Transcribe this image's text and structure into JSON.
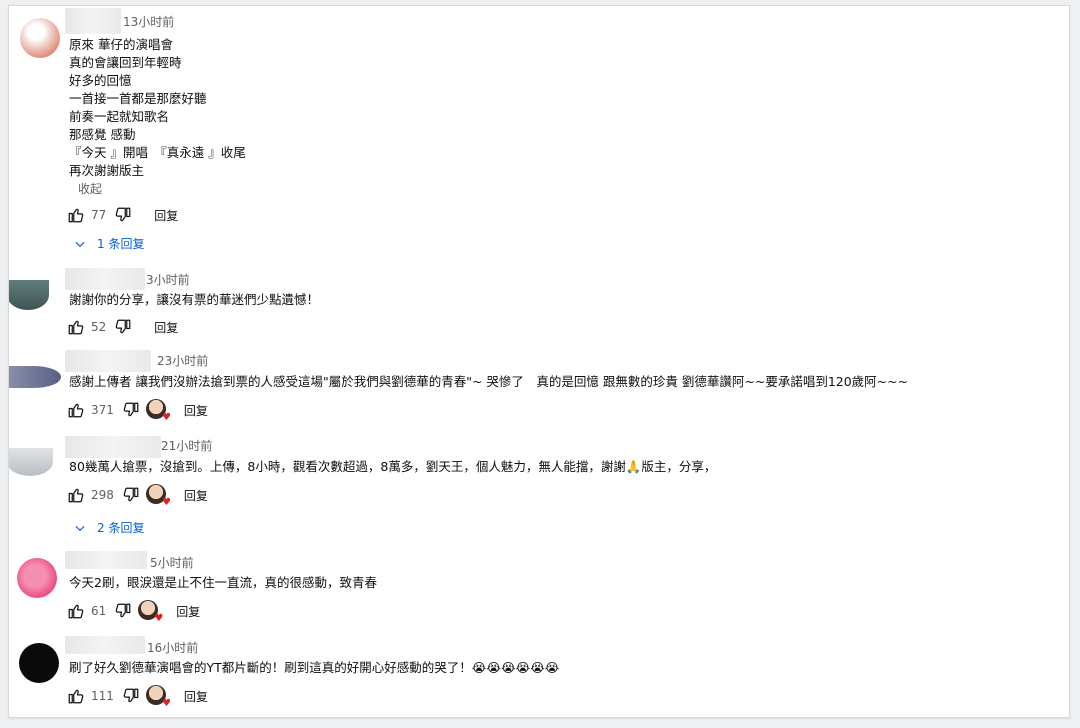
{
  "comments": [
    {
      "time": "13小时前",
      "lines": [
        "原來 華仔的演唱會",
        "真的會讓回到年輕時",
        "好多的回憶",
        "一首接一首都是那麼好聽",
        "前奏一起就知歌名",
        "那感覺 感動",
        "『今天 』開唱　『真永遠 』收尾",
        "再次謝謝版主"
      ],
      "collapse_label": "收起",
      "likes": "77",
      "reply_label": "回复",
      "replies_label": "1 条回复"
    },
    {
      "time": "3小时前",
      "lines": [
        "謝謝你的分享，讓沒有票的華迷們少點遺憾！"
      ],
      "likes": "52",
      "reply_label": "回复"
    },
    {
      "time": "23小时前",
      "lines": [
        "感謝上傳者 讓我們沒辦法搶到票的人感受這場\"屬於我們與劉德華的青春\"~ 哭慘了　真的是回憶 跟無數的珍貴 劉德華讚阿~~要承諾唱到120歲阿~~~"
      ],
      "likes": "371",
      "reply_label": "回复"
    },
    {
      "time": "21小时前",
      "lines": [
        "80幾萬人搶票，沒搶到。上傳，8小時，觀看次數超過，8萬多，劉天王，個人魅力，無人能擋，謝謝🙏版主，分享，"
      ],
      "likes": "298",
      "reply_label": "回复",
      "replies_label": "2 条回复"
    },
    {
      "time": "5小时前",
      "lines": [
        "今天2刷，眼淚還是止不住一直流，真的很感動，致青春"
      ],
      "likes": "61",
      "reply_label": "回复"
    },
    {
      "time": "16小时前",
      "lines": [
        "刷了好久劉德華演唱會的YT都片斷的！刷到這真的好開心好感動的哭了！😭😭😭😭😭😭"
      ],
      "likes": "111",
      "reply_label": "回复"
    }
  ],
  "colors": {
    "link": "#065fd4",
    "secondary": "#606060",
    "text": "#0f0f0f"
  }
}
